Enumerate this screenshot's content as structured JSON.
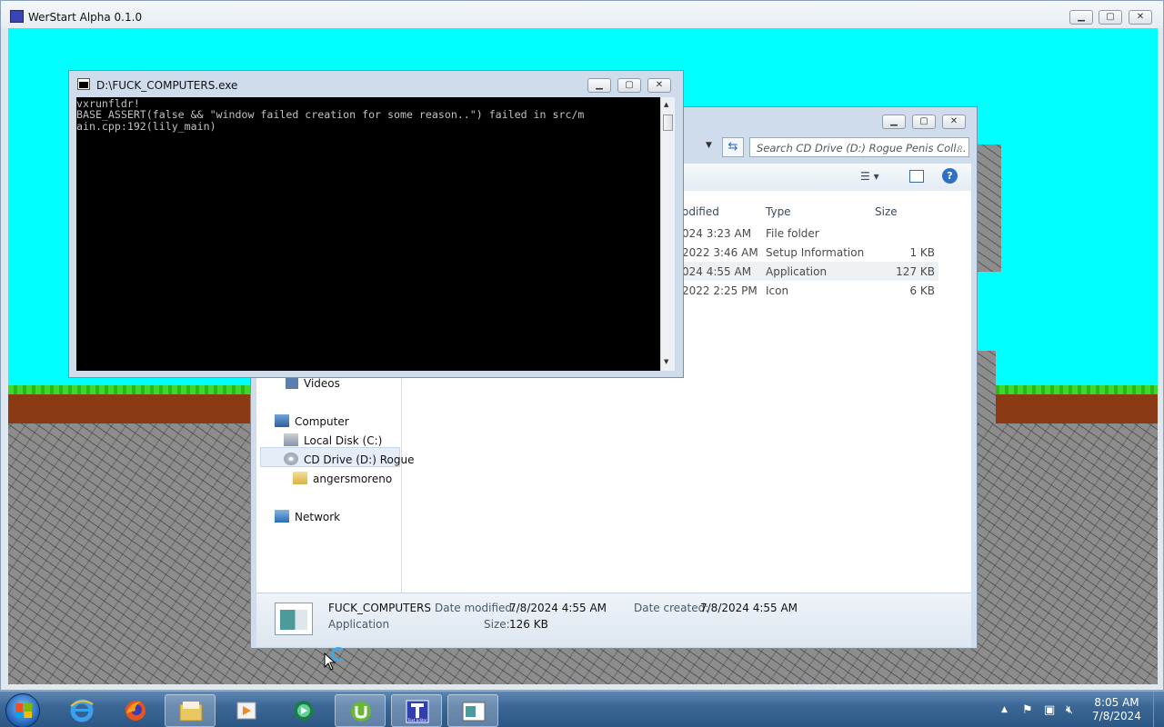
{
  "game_window": {
    "title": "WerStart Alpha 0.1.0",
    "colors": {
      "sky": "#00ffff",
      "grass": "#3fd82a",
      "dirt": "#8a3a15",
      "stone": "#8d8d8d"
    }
  },
  "console": {
    "title": "D:\\FUCK_COMPUTERS.exe",
    "lines": [
      "vxrunfldr!",
      "BASE_ASSERT(false && \"window failed creation for some reason..\") failed in src/m",
      "ain.cpp:192(lily_main)"
    ]
  },
  "explorer": {
    "search_placeholder": "Search CD Drive (D:) Rogue Penis Coll...",
    "columns": {
      "modified": "odified",
      "type": "Type",
      "size": "Size"
    },
    "files": [
      {
        "modified": "024 3:23 AM",
        "type": "File folder",
        "size": ""
      },
      {
        "modified": "2022 3:46 AM",
        "type": "Setup Information",
        "size": "1 KB"
      },
      {
        "modified": "024 4:55 AM",
        "type": "Application",
        "size": "127 KB"
      },
      {
        "modified": "2022 2:25 PM",
        "type": "Icon",
        "size": "6 KB"
      }
    ],
    "nav": {
      "videos": "Videos",
      "computer": "Computer",
      "local_disk": "Local Disk (C:)",
      "cd_drive": "CD Drive (D:) Rogue",
      "folder": "angersmoreno",
      "network": "Network"
    },
    "details": {
      "name": "FUCK_COMPUTERS",
      "kind": "Application",
      "date_modified_label": "Date modified:",
      "date_modified": "7/8/2024 4:55 AM",
      "date_created_label": "Date created:",
      "date_created": "7/8/2024 4:55 AM",
      "size_label": "Size:",
      "size": "126 KB"
    }
  },
  "taskbar": {
    "time": "8:05 AM",
    "date": "7/8/2024",
    "apps": [
      "internet-explorer",
      "firefox",
      "file-explorer",
      "media-player",
      "media-center",
      "utorrent",
      "text-editor",
      "console-app"
    ],
    "app_caption": "Text Editor"
  }
}
